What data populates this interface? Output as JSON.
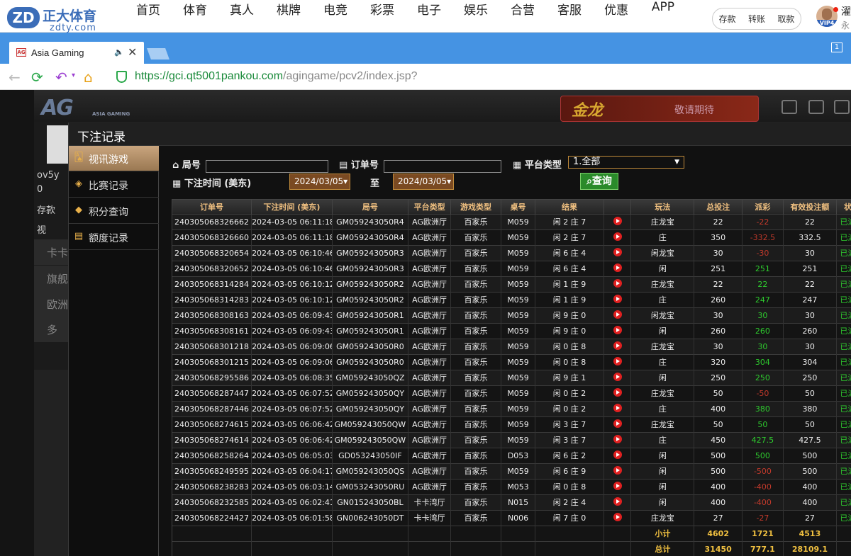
{
  "site": {
    "logo_mark": "ZD",
    "logo_name": "正大体育",
    "logo_sub": "zdty.com",
    "nav": [
      "首页",
      "体育",
      "真人",
      "棋牌",
      "电竞",
      "彩票",
      "电子",
      "娱乐",
      "合营",
      "客服",
      "优惠",
      "APP"
    ],
    "account": [
      "存款",
      "转账",
      "取款"
    ],
    "vip_badge": "VIP4",
    "user_line1": "濯",
    "user_line2": "永"
  },
  "browser": {
    "tab_title": "Asia Gaming",
    "tab_icon_text": "AG",
    "tab_count": "1",
    "url_domain": "https://gci.qt5001pankou.com",
    "url_path": "/agingame/pcv2/index.jsp?"
  },
  "game": {
    "logo": "AG",
    "logo_sub": "ASIA GAMING",
    "promo_title": "金龙",
    "promo_wait": "敬请期待",
    "left_items": [
      "ov5y",
      "0",
      "存款",
      "视"
    ],
    "left_big": [
      "卡卡",
      "旗舰",
      "欧洲",
      "多"
    ]
  },
  "panel": {
    "title": "下注记录",
    "menu": [
      {
        "icon": "cards-icon",
        "label": "视讯游戏",
        "active": true
      },
      {
        "icon": "tag-icon",
        "label": "比赛记录",
        "active": false
      },
      {
        "icon": "diamond-icon",
        "label": "积分查询",
        "active": false
      },
      {
        "icon": "document-icon",
        "label": "额度记录",
        "active": false
      }
    ],
    "filters": {
      "round_label": "局号",
      "order_label": "订单号",
      "platform_label": "平台类型",
      "platform_value": "1.全部",
      "time_label": "下注时间 (美东)",
      "date_from": "2024/03/05",
      "date_to": "2024/03/05",
      "to_label": "至",
      "query_label": "查询"
    },
    "table": {
      "headers": [
        "订单号",
        "下注时间 (美东)",
        "局号",
        "平台类型",
        "游戏类型",
        "桌号",
        "结果",
        "",
        "玩法",
        "总投注",
        "派彩",
        "有效投注额",
        "状态"
      ],
      "rows": [
        [
          "240305068326662",
          "2024-03-05 06:11:18",
          "GM059243050R4",
          "AG欧洲厅",
          "百家乐",
          "M059",
          "闲 2 庄 7",
          "庄龙宝",
          "22",
          "-22",
          "22",
          "已派彩"
        ],
        [
          "240305068326660",
          "2024-03-05 06:11:18",
          "GM059243050R4",
          "AG欧洲厅",
          "百家乐",
          "M059",
          "闲 2 庄 7",
          "庄",
          "350",
          "-332.5",
          "332.5",
          "已派彩"
        ],
        [
          "240305068320654",
          "2024-03-05 06:10:46",
          "GM059243050R3",
          "AG欧洲厅",
          "百家乐",
          "M059",
          "闲 6 庄 4",
          "闲龙宝",
          "30",
          "-30",
          "30",
          "已派彩"
        ],
        [
          "240305068320652",
          "2024-03-05 06:10:46",
          "GM059243050R3",
          "AG欧洲厅",
          "百家乐",
          "M059",
          "闲 6 庄 4",
          "闲",
          "251",
          "251",
          "251",
          "已派彩"
        ],
        [
          "240305068314284",
          "2024-03-05 06:10:12",
          "GM059243050R2",
          "AG欧洲厅",
          "百家乐",
          "M059",
          "闲 1 庄 9",
          "庄龙宝",
          "22",
          "22",
          "22",
          "已派彩"
        ],
        [
          "240305068314283",
          "2024-03-05 06:10:12",
          "GM059243050R2",
          "AG欧洲厅",
          "百家乐",
          "M059",
          "闲 1 庄 9",
          "庄",
          "260",
          "247",
          "247",
          "已派彩"
        ],
        [
          "240305068308163",
          "2024-03-05 06:09:43",
          "GM059243050R1",
          "AG欧洲厅",
          "百家乐",
          "M059",
          "闲 9 庄 0",
          "闲龙宝",
          "30",
          "30",
          "30",
          "已派彩"
        ],
        [
          "240305068308161",
          "2024-03-05 06:09:43",
          "GM059243050R1",
          "AG欧洲厅",
          "百家乐",
          "M059",
          "闲 9 庄 0",
          "闲",
          "260",
          "260",
          "260",
          "已派彩"
        ],
        [
          "240305068301218",
          "2024-03-05 06:09:06",
          "GM059243050R0",
          "AG欧洲厅",
          "百家乐",
          "M059",
          "闲 0 庄 8",
          "庄龙宝",
          "30",
          "30",
          "30",
          "已派彩"
        ],
        [
          "240305068301215",
          "2024-03-05 06:09:06",
          "GM059243050R0",
          "AG欧洲厅",
          "百家乐",
          "M059",
          "闲 0 庄 8",
          "庄",
          "320",
          "304",
          "304",
          "已派彩"
        ],
        [
          "240305068295586",
          "2024-03-05 06:08:35",
          "GM059243050QZ",
          "AG欧洲厅",
          "百家乐",
          "M059",
          "闲 9 庄 1",
          "闲",
          "250",
          "250",
          "250",
          "已派彩"
        ],
        [
          "240305068287447",
          "2024-03-05 06:07:52",
          "GM059243050QY",
          "AG欧洲厅",
          "百家乐",
          "M059",
          "闲 0 庄 2",
          "庄龙宝",
          "50",
          "-50",
          "50",
          "已派彩"
        ],
        [
          "240305068287446",
          "2024-03-05 06:07:52",
          "GM059243050QY",
          "AG欧洲厅",
          "百家乐",
          "M059",
          "闲 0 庄 2",
          "庄",
          "400",
          "380",
          "380",
          "已派彩"
        ],
        [
          "240305068274615",
          "2024-03-05 06:06:42",
          "GM059243050QW",
          "AG欧洲厅",
          "百家乐",
          "M059",
          "闲 3 庄 7",
          "庄龙宝",
          "50",
          "50",
          "50",
          "已派彩"
        ],
        [
          "240305068274614",
          "2024-03-05 06:06:42",
          "GM059243050QW",
          "AG欧洲厅",
          "百家乐",
          "M059",
          "闲 3 庄 7",
          "庄",
          "450",
          "427.5",
          "427.5",
          "已派彩"
        ],
        [
          "240305068258264",
          "2024-03-05 06:05:03",
          "GD053243050IF",
          "AG欧洲厅",
          "百家乐",
          "D053",
          "闲 6 庄 2",
          "闲",
          "500",
          "500",
          "500",
          "已派彩"
        ],
        [
          "240305068249595",
          "2024-03-05 06:04:17",
          "GM059243050QS",
          "AG欧洲厅",
          "百家乐",
          "M059",
          "闲 6 庄 9",
          "闲",
          "500",
          "-500",
          "500",
          "已派彩"
        ],
        [
          "240305068238283",
          "2024-03-05 06:03:14",
          "GM053243050RU",
          "AG欧洲厅",
          "百家乐",
          "M053",
          "闲 0 庄 8",
          "闲",
          "400",
          "-400",
          "400",
          "已派彩"
        ],
        [
          "240305068232585",
          "2024-03-05 06:02:41",
          "GN015243050BL",
          "卡卡湾厅",
          "百家乐",
          "N015",
          "闲 2 庄 4",
          "闲",
          "400",
          "-400",
          "400",
          "已派彩"
        ],
        [
          "240305068224427",
          "2024-03-05 06:01:58",
          "GN006243050DT",
          "卡卡湾厅",
          "百家乐",
          "N006",
          "闲 7 庄 0",
          "庄龙宝",
          "27",
          "-27",
          "27",
          "已派彩"
        ]
      ],
      "subtotal": {
        "label": "小计",
        "bet": "4602",
        "payout": "1721",
        "valid": "4513"
      },
      "total": {
        "label": "总计",
        "bet": "31450",
        "payout": "777.1",
        "valid": "28109.1"
      }
    }
  },
  "colors": {
    "accent_blue": "#4593e3",
    "win": "#2ecc2e",
    "loss": "#c0392b",
    "gold": "#f0c040"
  }
}
